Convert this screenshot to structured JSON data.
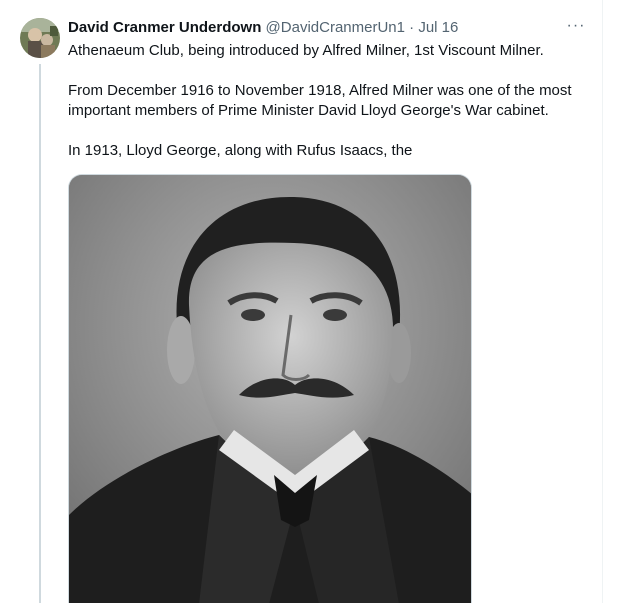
{
  "tweet": {
    "author_name": "David Cranmer Underdown",
    "author_handle": "@DavidCranmerUn1",
    "separator": "·",
    "timestamp": "Jul 16",
    "more_label": "···",
    "paragraphs": [
      "Athenaeum Club, being introduced by Alfred Milner, 1st Viscount Milner.",
      "From December 1916 to November 1918, Alfred Milner was one of the most important members of Prime Minister David Lloyd George's War cabinet.",
      "In 1913, Lloyd George, along with Rufus Isaacs, the"
    ]
  },
  "icons": {
    "more": "more-options-icon",
    "avatar": "avatar-image"
  },
  "colors": {
    "text": "#0f1419",
    "secondary": "#536471",
    "thread_line": "#cfd9de"
  }
}
